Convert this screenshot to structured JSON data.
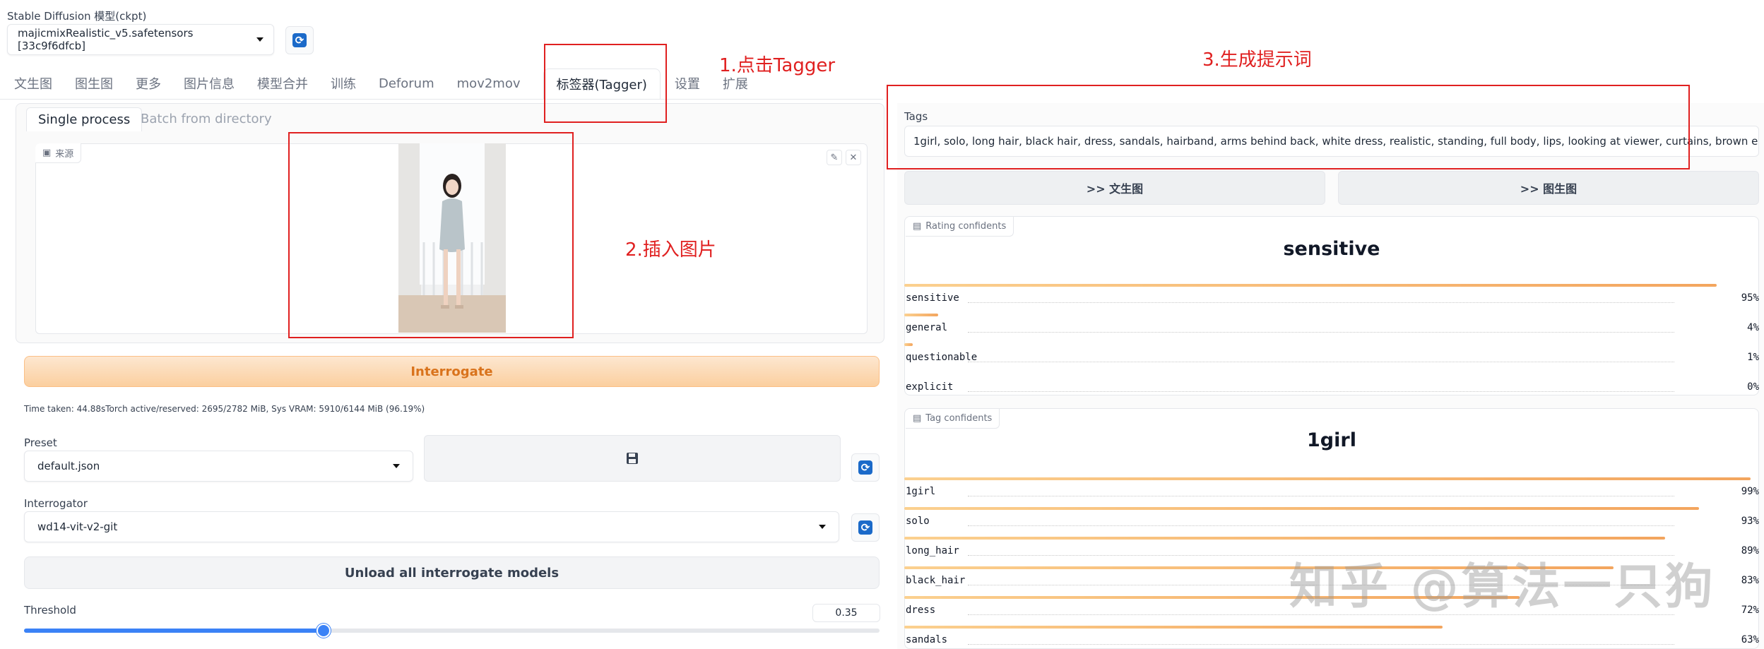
{
  "model": {
    "label": "Stable Diffusion 模型(ckpt)",
    "value": "majicmixRealistic_v5.safetensors [33c9f6dfcb]"
  },
  "tabs": [
    "文生图",
    "图生图",
    "更多",
    "图片信息",
    "模型合并",
    "训练",
    "Deforum",
    "mov2mov",
    "标签器(Tagger)",
    "设置",
    "扩展"
  ],
  "subtabs": [
    "Single process",
    "Batch from directory"
  ],
  "image": {
    "source_label": "来源",
    "edit_icon": "pencil-icon",
    "close_icon": "close-icon"
  },
  "interrogate_label": "Interrogate",
  "time_info": "Time taken: 44.88sTorch active/reserved: 2695/2782 MiB, Sys VRAM: 5910/6144 MiB (96.19%)",
  "preset": {
    "label": "Preset",
    "value": "default.json"
  },
  "interrogator": {
    "label": "Interrogator",
    "value": "wd14-vit-v2-git"
  },
  "unload_label": "Unload all interrogate models",
  "threshold": {
    "label": "Threshold",
    "value": "0.35",
    "fraction": 0.35
  },
  "tags": {
    "label": "Tags",
    "value": "1girl, solo, long hair, black hair, dress, sandals, hairband, arms behind back, white dress, realistic, standing, full body, lips, looking at viewer, curtains, brown eyes"
  },
  "send_txt2img": ">> 文生图",
  "send_img2img": ">> 图生图",
  "rating": {
    "label": "Rating confidents",
    "title": "sensitive",
    "rows": [
      {
        "name": "sensitive",
        "pct": "95%",
        "value": 0.95
      },
      {
        "name": "general",
        "pct": "4%",
        "value": 0.04
      },
      {
        "name": "questionable",
        "pct": "1%",
        "value": 0.01
      },
      {
        "name": "explicit",
        "pct": "0%",
        "value": 0.0
      }
    ]
  },
  "tag_conf": {
    "label": "Tag confidents",
    "title": "1girl",
    "rows": [
      {
        "name": "1girl",
        "pct": "99%",
        "value": 0.99
      },
      {
        "name": "solo",
        "pct": "93%",
        "value": 0.93
      },
      {
        "name": "long_hair",
        "pct": "89%",
        "value": 0.89
      },
      {
        "name": "black_hair",
        "pct": "83%",
        "value": 0.83
      },
      {
        "name": "dress",
        "pct": "72%",
        "value": 0.72
      },
      {
        "name": "sandals",
        "pct": "63%",
        "value": 0.63
      }
    ]
  },
  "annotations": {
    "step1": "1.点击Tagger",
    "step2": "2.插入图片",
    "step3": "3.生成提示词"
  },
  "watermark": "知乎 @算法一只狗",
  "colors": {
    "accent_orange": "#d9731c",
    "annotation_red": "#e02020",
    "slider_blue": "#3b82f6"
  }
}
